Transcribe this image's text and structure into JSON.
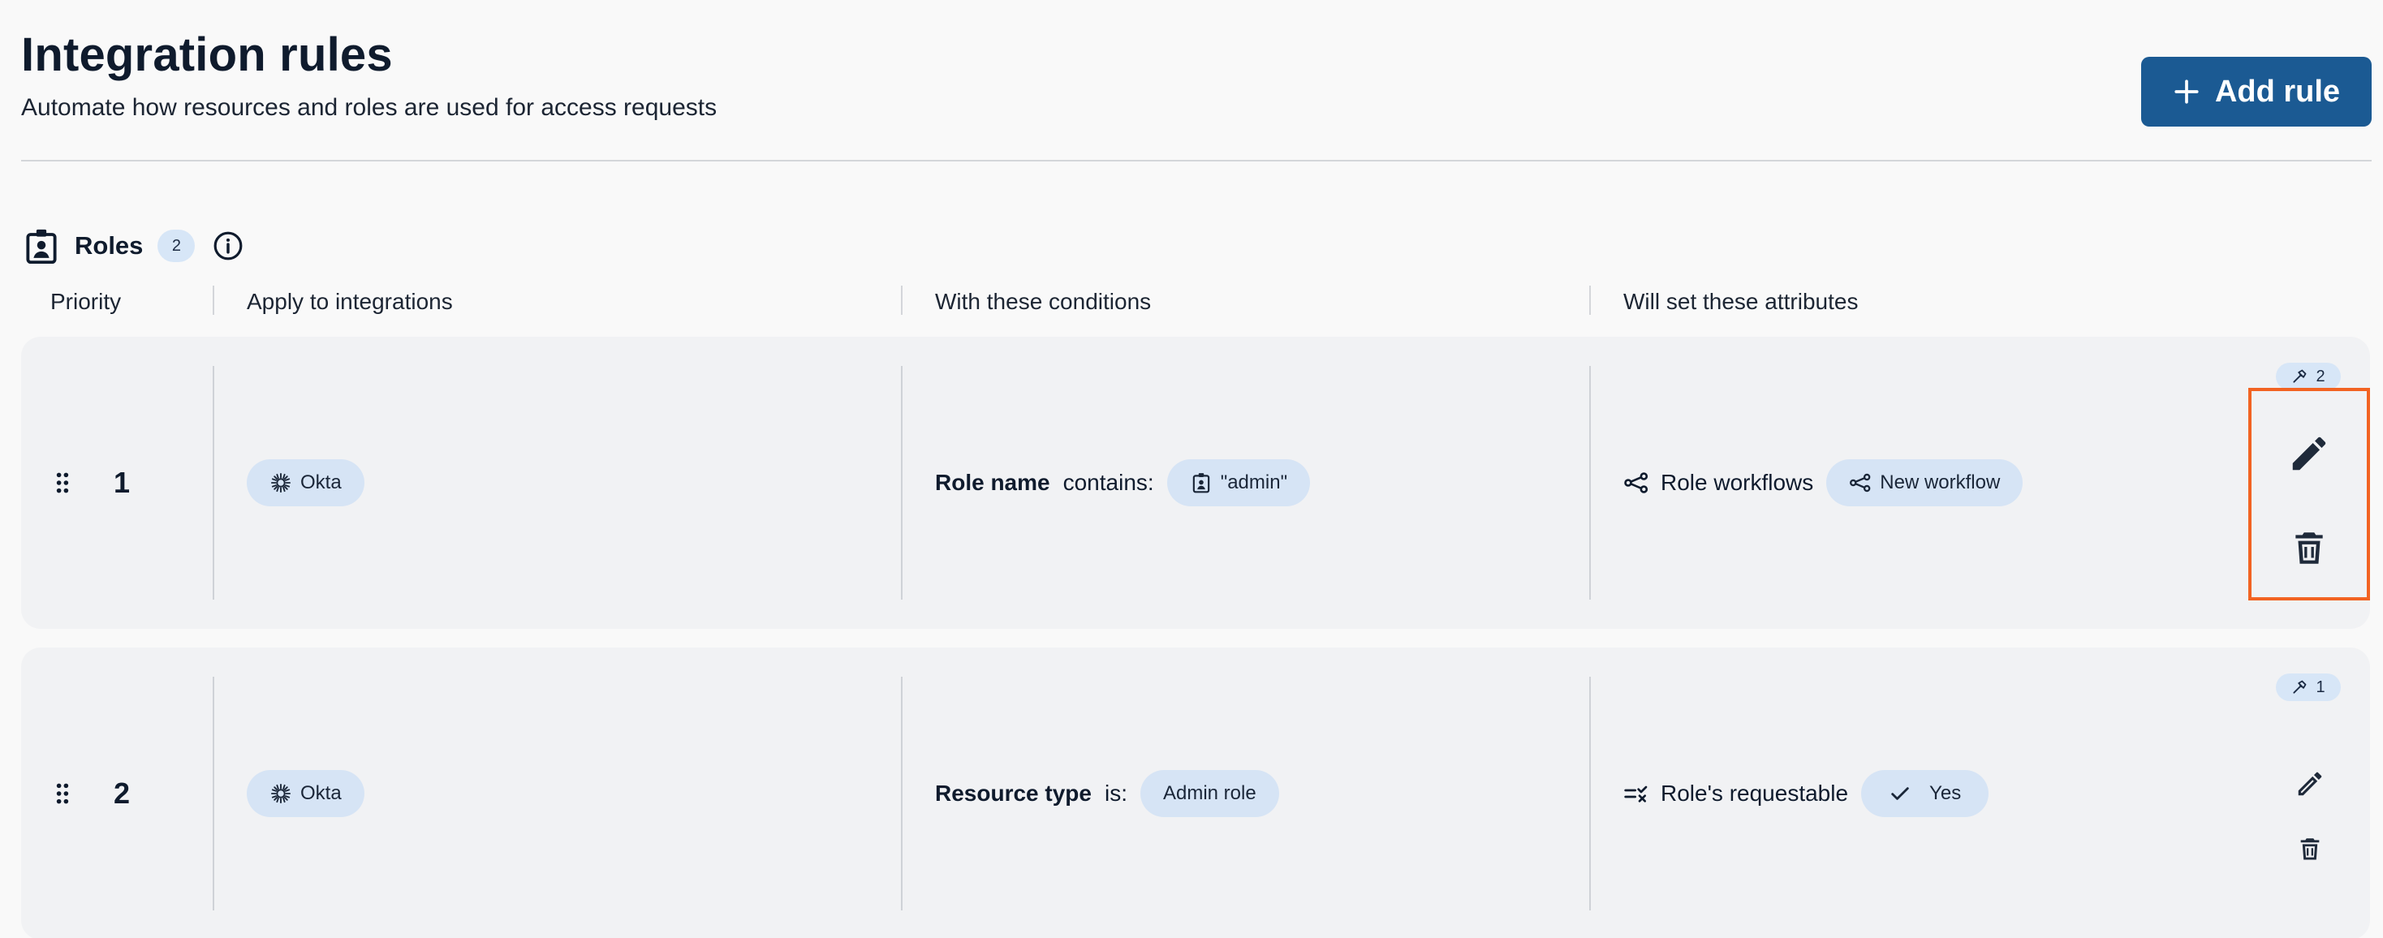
{
  "header": {
    "title": "Integration rules",
    "subtitle": "Automate how resources and roles are used for access requests",
    "add_rule_label": "Add rule"
  },
  "section": {
    "title": "Roles",
    "count": "2",
    "icon": "role-badge-icon",
    "info_icon": "info-icon"
  },
  "columns": {
    "priority": "Priority",
    "integrations": "Apply to integrations",
    "conditions": "With these conditions",
    "attributes": "Will set these attributes"
  },
  "rules": [
    {
      "priority": "1",
      "integration": "Okta",
      "condition": {
        "field": "Role name",
        "operator": "contains:",
        "value": "\"admin\"",
        "value_icon": "role-badge-icon"
      },
      "attribute": {
        "name": "Role workflows",
        "icon": "workflow-icon",
        "value": "New workflow",
        "value_icon": "workflow-icon"
      },
      "rule_count": "2"
    },
    {
      "priority": "2",
      "integration": "Okta",
      "condition": {
        "field": "Resource type",
        "operator": "is:",
        "value": "Admin role"
      },
      "attribute": {
        "name": "Role's requestable",
        "icon": "requestable-icon",
        "value": "Yes",
        "value_icon": "check-icon"
      },
      "rule_count": "1"
    }
  ],
  "colors": {
    "accent": "#1b5a93",
    "pill_bg": "#d6e4f5",
    "card_bg": "#f1f2f4",
    "highlight": "#f26322"
  }
}
